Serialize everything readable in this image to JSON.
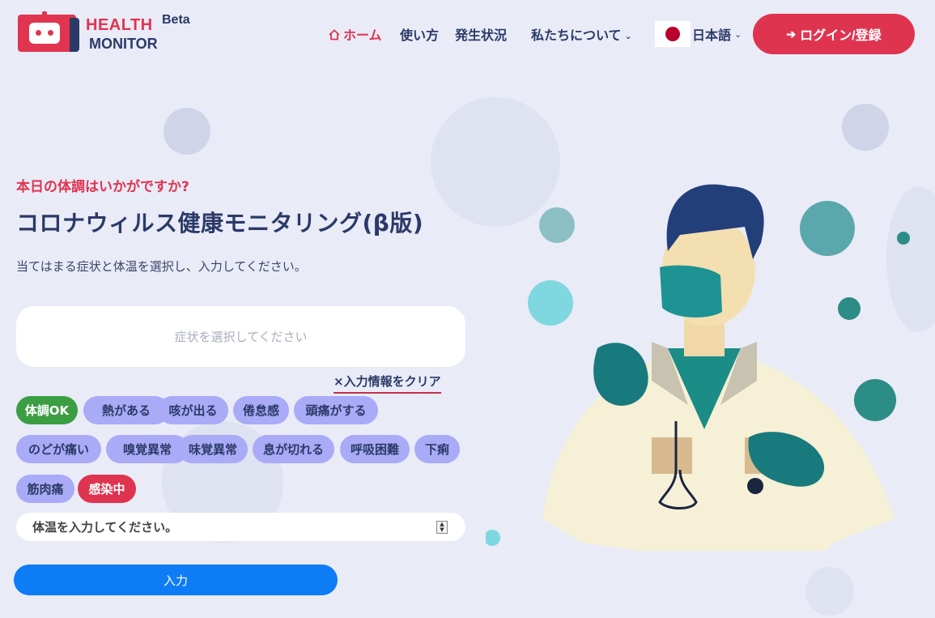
{
  "header": {
    "logo": {
      "line1": "HEALTH",
      "line2": "MONITOR",
      "badge": "Beta"
    },
    "nav": [
      {
        "label": "ホーム",
        "icon": "home-icon",
        "active": true
      },
      {
        "label": "使い方"
      },
      {
        "label": "発生状況"
      },
      {
        "label": "私たちについて",
        "has_dropdown": true
      }
    ],
    "language": {
      "label": "日本語",
      "flag": "japan-flag-icon"
    },
    "login_label": "ログイン/登録"
  },
  "main": {
    "tagline": "本日の体調はいかがですか?",
    "title": "コロナウィルス健康モニタリング(β版)",
    "description": "当てはまる症状と体温を選択し、入力してください。",
    "symptom_placeholder": "症状を選択してください",
    "clear_label": "入力情報をクリア",
    "clear_icon": "×",
    "symptoms": [
      {
        "label": "体調OK",
        "state": "ok"
      },
      {
        "label": "熱がある"
      },
      {
        "label": "咳が出る"
      },
      {
        "label": "倦怠感"
      },
      {
        "label": "頭痛がする"
      },
      {
        "label": "のどが痛い"
      },
      {
        "label": "嗅覚異常"
      },
      {
        "label": "味覚異常"
      },
      {
        "label": "息が切れる"
      },
      {
        "label": "呼吸困難"
      },
      {
        "label": "下痢"
      },
      {
        "label": "筋肉痛"
      },
      {
        "label": "感染中",
        "state": "infected"
      }
    ],
    "temperature_placeholder": "体温を入力してください。",
    "submit_label": "入力"
  },
  "colors": {
    "brand_red": "#df3450",
    "navy": "#2b3a67",
    "chip_purple": "#a9abf7",
    "ok_green": "#3c9e43",
    "submit_blue": "#0d7cf5",
    "background": "#e9ebf7"
  }
}
